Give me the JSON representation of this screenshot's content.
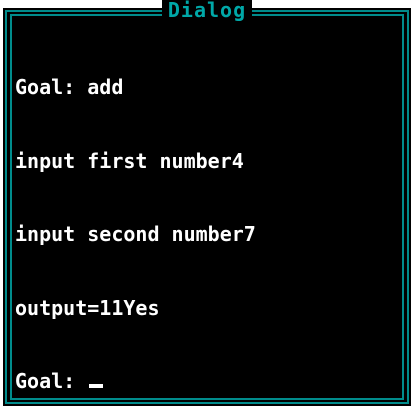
{
  "window": {
    "title": "Dialog"
  },
  "console": {
    "lines": [
      "Goal: add",
      "input first number4",
      "input second number7",
      "output=11Yes"
    ],
    "prompt": "Goal: "
  },
  "colors": {
    "background": "#000000",
    "frame": "#008c8c",
    "title": "#00a8a8",
    "text": "#ffffff"
  }
}
